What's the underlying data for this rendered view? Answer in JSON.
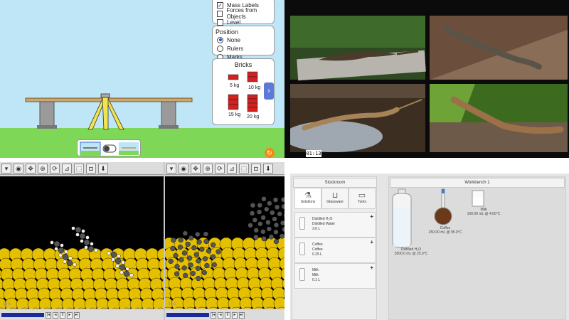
{
  "balance": {
    "labels_panel": {
      "options": [
        {
          "label": "Mass Labels",
          "checked": true
        },
        {
          "label": "Forces from Objects",
          "checked": false
        },
        {
          "label": "Level",
          "checked": false
        }
      ]
    },
    "position_panel": {
      "title": "Position",
      "options": [
        {
          "label": "None",
          "selected": true
        },
        {
          "label": "Rulers",
          "selected": false
        },
        {
          "label": "Marks",
          "selected": false
        }
      ]
    },
    "bricks_panel": {
      "title": "Bricks",
      "bricks": [
        "5 kg",
        "10 kg",
        "15 kg",
        "20 kg"
      ]
    },
    "next_icon": "chevron-right",
    "reset_icon": "reset-arrow",
    "colors": {
      "sky": "#bfe6f7",
      "grass": "#7ed757",
      "brick": "#d32020",
      "support": "#f2e44a"
    }
  },
  "lizard_video": {
    "timecode": "01:13"
  },
  "molecule_viewer": {
    "toolbar_icons": [
      "dropdown-icon",
      "eye-icon",
      "move-icon",
      "zoom-icon",
      "rotate-icon",
      "measure-icon",
      "select-icon",
      "camera-icon",
      "save-icon"
    ],
    "frame_label": "0 ps",
    "colors": {
      "gold": "#e5c000",
      "carbon": "#555555",
      "hydrogen": "#f0f0f0"
    }
  },
  "lab": {
    "stockroom_title": "Stockroom",
    "workbench_title": "Workbench 1",
    "tabs": [
      "Solutions",
      "Glassware",
      "Tools"
    ],
    "items": [
      {
        "name": "Distilled H₂O",
        "desc": "Distilled Water",
        "volume": "3.0 L"
      },
      {
        "name": "Coffee",
        "desc": "Coffee",
        "volume": "0.25 L"
      },
      {
        "name": "Milk",
        "desc": "Milk",
        "volume": "0.1 L"
      }
    ],
    "workbench": [
      {
        "name": "Distilled H₂O",
        "detail": "3000.0 mL @ 25.0°C"
      },
      {
        "name": "Coffee",
        "detail": "250.00 mL @ 95.0°C"
      },
      {
        "name": "Milk",
        "detail": "100.00 mL @ 4.00°C"
      }
    ]
  }
}
